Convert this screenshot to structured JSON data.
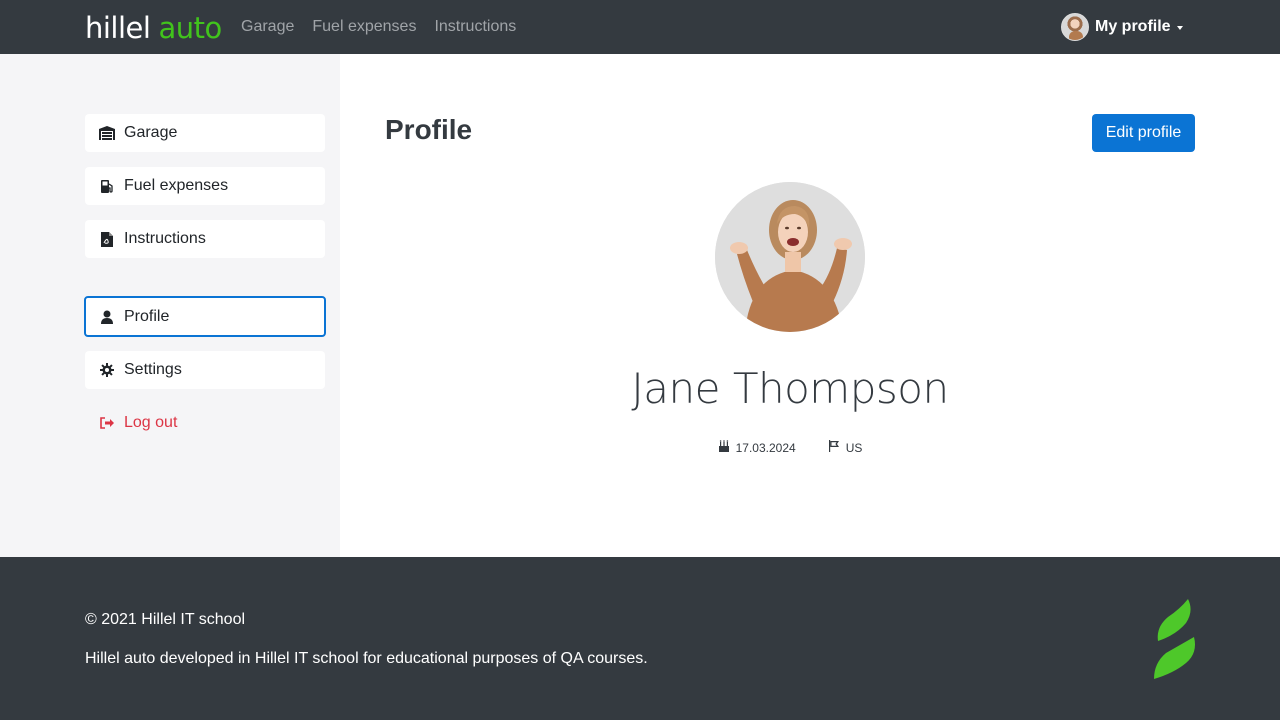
{
  "header": {
    "logo_word1": "hillel",
    "logo_word2": "auto",
    "nav": [
      "Garage",
      "Fuel expenses",
      "Instructions"
    ],
    "profile_label": "My profile"
  },
  "sidebar": {
    "items": [
      {
        "label": "Garage",
        "icon": "garage-icon"
      },
      {
        "label": "Fuel expenses",
        "icon": "fuel-icon"
      },
      {
        "label": "Instructions",
        "icon": "pdf-file-icon"
      },
      {
        "label": "Profile",
        "icon": "user-icon",
        "active": true
      },
      {
        "label": "Settings",
        "icon": "gear-icon"
      },
      {
        "label": "Log out",
        "icon": "logout-icon"
      }
    ]
  },
  "main": {
    "title": "Profile",
    "edit_label": "Edit profile",
    "name": "Jane Thompson",
    "birthday": "17.03.2024",
    "country": "US"
  },
  "footer": {
    "copyright": "© 2021 Hillel IT school",
    "description": "Hillel auto developed in Hillel IT school for educational purposes of QA courses."
  },
  "colors": {
    "header_bg": "#343a40",
    "logo_accent": "#41c41c",
    "primary": "#0b74d4",
    "danger": "#dc3545",
    "sidebar_bg": "#f5f5f7"
  }
}
